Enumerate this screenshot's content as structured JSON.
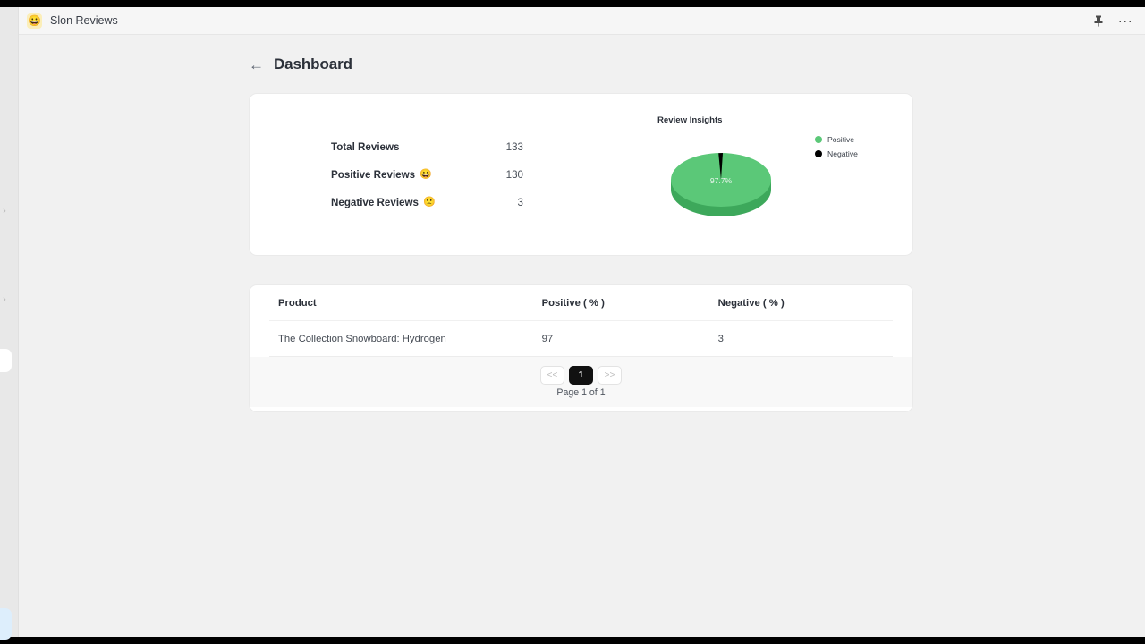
{
  "window": {
    "brand_icon": "smiley-face-icon",
    "brand_icon_glyph": "😀",
    "brand_title": "Slon Reviews",
    "pin_icon": "pin-icon",
    "pin_glyph": "📌",
    "more_icon": "ellipsis-icon",
    "more_glyph": "···"
  },
  "page": {
    "back_arrow": "←",
    "title": "Dashboard"
  },
  "summary": {
    "stats": [
      {
        "label": "Total Reviews",
        "emoji": "",
        "value": "133"
      },
      {
        "label": "Positive Reviews",
        "emoji": "😀",
        "value": "130"
      },
      {
        "label": "Negative Reviews",
        "emoji": "🙁",
        "value": "3"
      }
    ]
  },
  "chart_data": {
    "type": "pie",
    "title": "Review Insights",
    "categories": [
      "Positive",
      "Negative"
    ],
    "values": [
      97.7,
      2.3
    ],
    "counts": [
      130,
      3
    ],
    "labels": [
      "97.7%",
      ""
    ],
    "colors": [
      "#5bc878",
      "#000000"
    ],
    "legend_position": "right",
    "three_d": true,
    "xlabel": "",
    "ylabel": ""
  },
  "table": {
    "columns": [
      "Product",
      "Positive ( % )",
      "Negative ( % )"
    ],
    "rows": [
      {
        "product": "The Collection Snowboard: Hydrogen",
        "positive": "97",
        "negative": "3"
      }
    ],
    "pagination": {
      "prev_label": "<<",
      "current_label": "1",
      "next_label": ">>",
      "caption": "Page 1 of 1"
    }
  },
  "rail": {
    "handle_glyph": "›"
  },
  "colors": {
    "accent_green": "#5bc878",
    "negative_black": "#000000",
    "page_bg": "#f1f1f1",
    "card_bg": "#ffffff",
    "active_page_bg": "#111111"
  }
}
